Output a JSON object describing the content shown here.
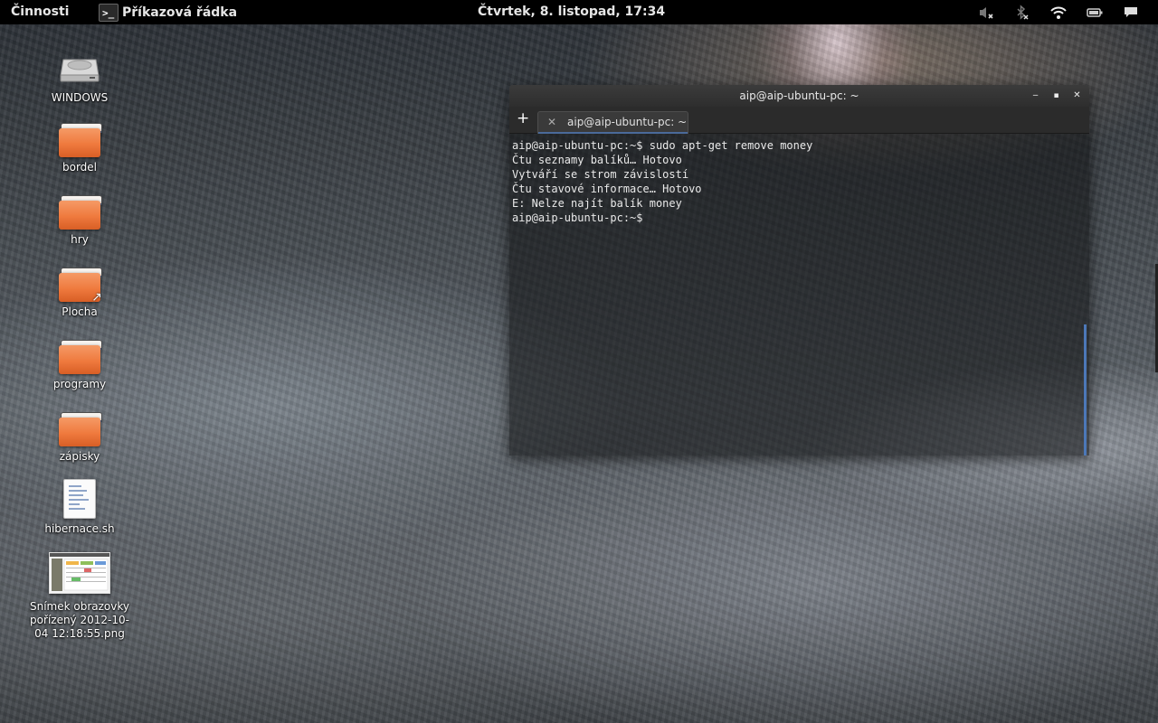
{
  "top_panel": {
    "activities": "Činnosti",
    "app_menu": {
      "icon_glyph": ">_",
      "label": "Příkazová řádka"
    },
    "clock": "Čtvrtek,  8. listopad, 17:34",
    "tray": [
      "volume-muted-icon",
      "bluetooth-off-icon",
      "wifi-icon",
      "battery-icon",
      "message-icon"
    ]
  },
  "desktop_icons": [
    {
      "label": "WINDOWS",
      "type": "drive"
    },
    {
      "label": "bordel",
      "type": "folder"
    },
    {
      "label": "hry",
      "type": "folder"
    },
    {
      "label": "Plocha",
      "type": "folder-link"
    },
    {
      "label": "programy",
      "type": "folder"
    },
    {
      "label": "zápisky",
      "type": "folder"
    },
    {
      "label": "hibernace.sh",
      "type": "script"
    },
    {
      "label": "Snímek obrazovky pořízený 2012-10-04 12:18:55.png",
      "type": "image"
    }
  ],
  "terminal": {
    "title": "aip@aip-ubuntu-pc: ~",
    "tab_label": "aip@aip-ubuntu-pc: ~",
    "buttons": {
      "minimize": "‒",
      "maximize": "▪",
      "close": "✕"
    },
    "new_tab": "+",
    "tab_close": "✕",
    "lines": [
      "aip@aip-ubuntu-pc:~$ sudo apt-get remove money",
      "Čtu seznamy balíků… Hotovo",
      "Vytváří se strom závislostí",
      "Čtu stavové informace… Hotovo",
      "E: Nelze najít balík money",
      "aip@aip-ubuntu-pc:~$ "
    ]
  },
  "colors": {
    "panel": "#000000",
    "folder": "#ef7a3e",
    "scroll_accent": "#4c78b8"
  }
}
